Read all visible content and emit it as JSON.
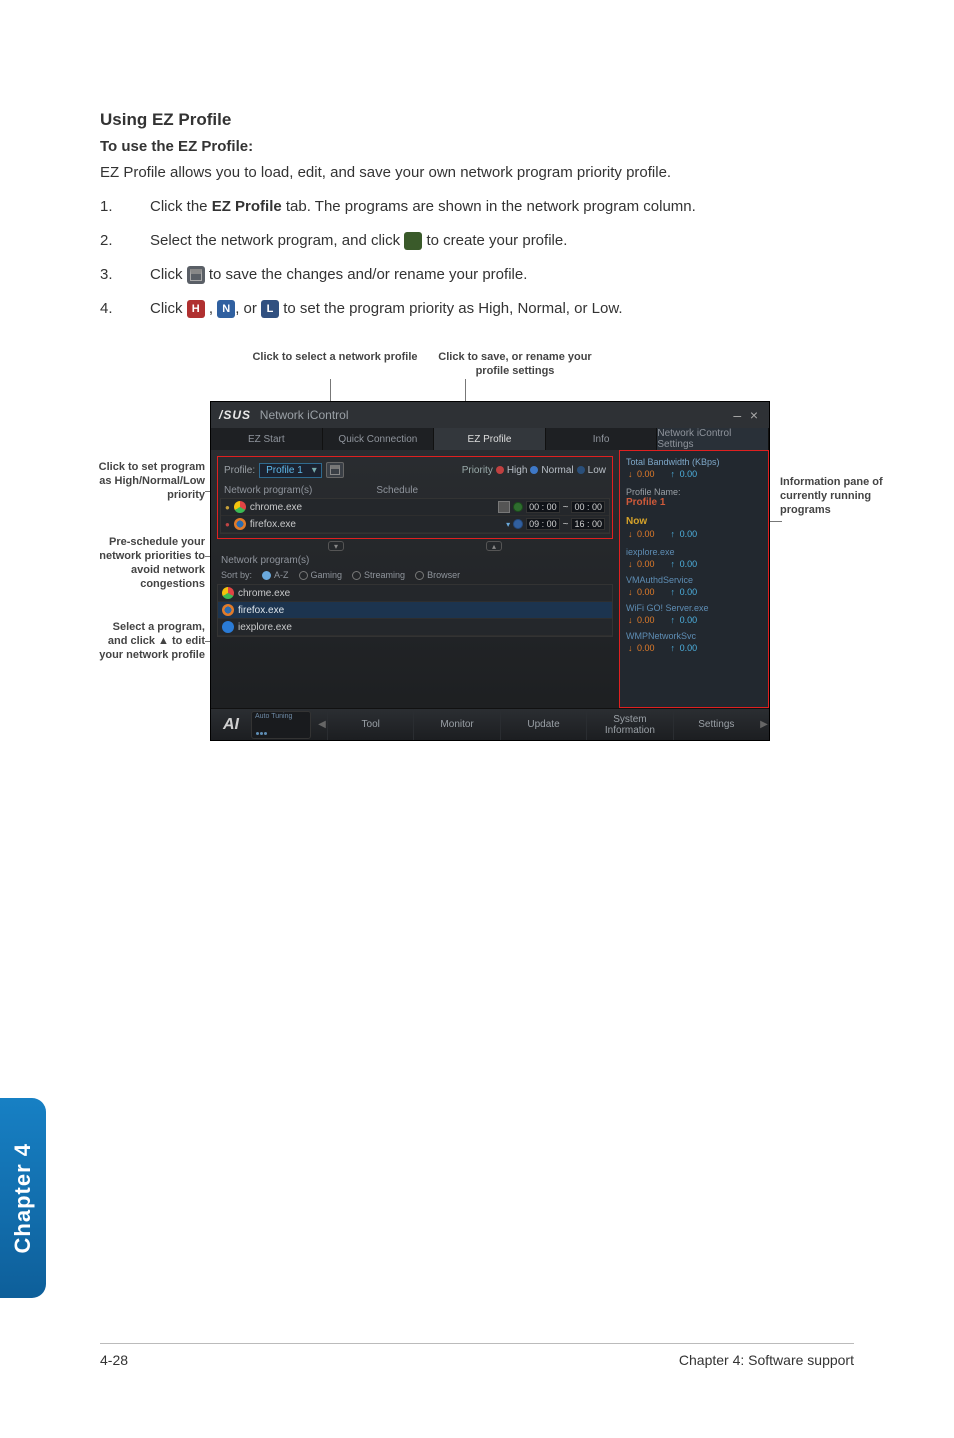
{
  "heading": "Using EZ Profile",
  "subheading": "To use the EZ Profile:",
  "intro": "EZ Profile allows you to load, edit, and save your own network program priority profile.",
  "steps": {
    "s1a": "Click the ",
    "s1b": "EZ Profile",
    "s1c": " tab. The programs are shown in the network program column.",
    "s2a": "Select the network program, and click ",
    "s2b": " to create your profile.",
    "s3a": "Click ",
    "s3b": " to save the changes and/or rename your profile.",
    "s4a": "Click ",
    "s4b": " , ",
    "s4c": ", or ",
    "s4d": " to set the program priority as High, Normal, or Low."
  },
  "icons": {
    "H": "H",
    "N": "N",
    "L": "L"
  },
  "callouts": {
    "top_left": "Click to select a network profile",
    "top_right": "Click to save, or rename your profile settings",
    "left1": "Click to set program as High/Normal/Low priority",
    "left2": "Pre-schedule your network priorities to avoid network congestions",
    "left3": "Select a program, and click ▲ to edit your network profile",
    "right1": "Information pane of currently running programs"
  },
  "app": {
    "logo": "/SUS",
    "title": "Network iControl",
    "tabs": [
      "EZ Start",
      "Quick Connection",
      "EZ Profile",
      "Info"
    ],
    "net_settings": "Network iControl Settings",
    "profile_label": "Profile:",
    "profile_value": "Profile 1",
    "priority_label": "Priority",
    "priority_opts": [
      "High",
      "Normal",
      "Low"
    ],
    "np_section": "Network program(s)",
    "schedule_section": "Schedule",
    "rows": [
      {
        "name": "chrome.exe",
        "time1": "00 : 00",
        "tilde": "~",
        "time2": "00 : 00"
      },
      {
        "name": "firefox.exe",
        "time1": "09 : 00",
        "tilde": "~",
        "time2": "16 : 00"
      }
    ],
    "sortby_label": "Sort by:",
    "sort_opts": [
      "A-Z",
      "Gaming",
      "Streaming",
      "Browser"
    ],
    "bottom_rows": [
      "chrome.exe",
      "firefox.exe",
      "iexplore.exe"
    ],
    "side": {
      "total_bw": "Total Bandwidth (KBps)",
      "dn": "0.00",
      "up": "0.00",
      "pname_label": "Profile Name:",
      "pname": "Profile 1",
      "now": "Now",
      "items": [
        "iexplore.exe",
        "VMAuthdService",
        "WiFi GO! Server.exe",
        "WMPNetworkSvc"
      ]
    },
    "bottombar": {
      "mini": "Auto Tuning",
      "items": [
        "Tool",
        "Monitor",
        "Update",
        "System Information",
        "Settings"
      ]
    }
  },
  "chapter_tab": "Chapter 4",
  "footer_left": "4-28",
  "footer_right": "Chapter 4: Software support"
}
